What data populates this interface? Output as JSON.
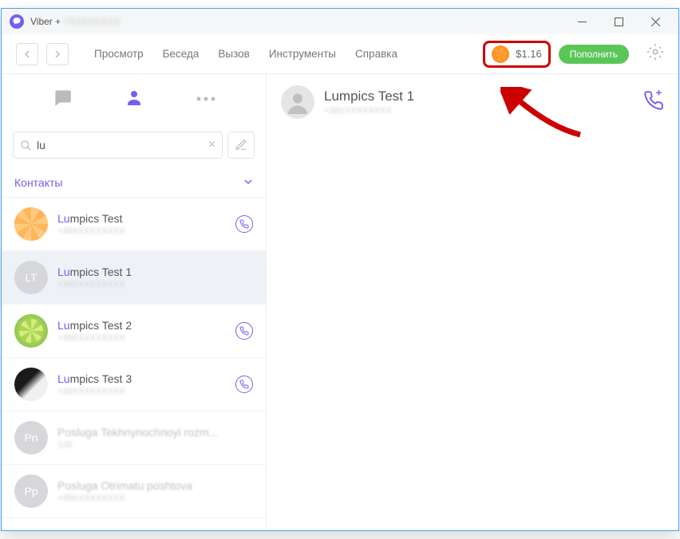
{
  "title": {
    "prefix": "Viber +",
    "blurred": "7XXXXXXXX"
  },
  "menu": {
    "view": "Просмотр",
    "chat": "Беседа",
    "call": "Вызов",
    "tools": "Инструменты",
    "help": "Справка"
  },
  "balance": {
    "amount": "$1.16",
    "topup": "Пополнить"
  },
  "search": {
    "value": "lu"
  },
  "section": {
    "contacts": "Контакты"
  },
  "contacts": [
    {
      "match": "Lu",
      "rest": "mpics Test",
      "sub": "+38XXXXXXXXX",
      "avatar_type": "orange",
      "has_viber": true,
      "selected": false
    },
    {
      "match": "Lu",
      "rest": "mpics Test 1",
      "sub": "+38XXXXXXXXX",
      "avatar_type": "initials",
      "initials": "LT",
      "has_viber": false,
      "selected": true
    },
    {
      "match": "Lu",
      "rest": "mpics Test 2",
      "sub": "+38XXXXXXXXX",
      "avatar_type": "lime",
      "has_viber": true,
      "selected": false
    },
    {
      "match": "Lu",
      "rest": "mpics Test 3",
      "sub": "+38XXXXXXXXX",
      "avatar_type": "bw",
      "has_viber": true,
      "selected": false
    },
    {
      "match": "",
      "rest": "Posluga Tekhnynochnoyi rozm...",
      "sub": "128",
      "avatar_type": "initials",
      "initials": "Pn",
      "has_viber": false,
      "selected": false,
      "dimmed": true
    },
    {
      "match": "",
      "rest": "Posluga Otrimatu poshtova",
      "sub": "+38XXXXXXXXX",
      "avatar_type": "initials",
      "initials": "Pp",
      "has_viber": false,
      "selected": false,
      "dimmed": true
    }
  ],
  "chat": {
    "name": "Lumpics Test 1",
    "sub": "+38XXXXXXXXX"
  }
}
